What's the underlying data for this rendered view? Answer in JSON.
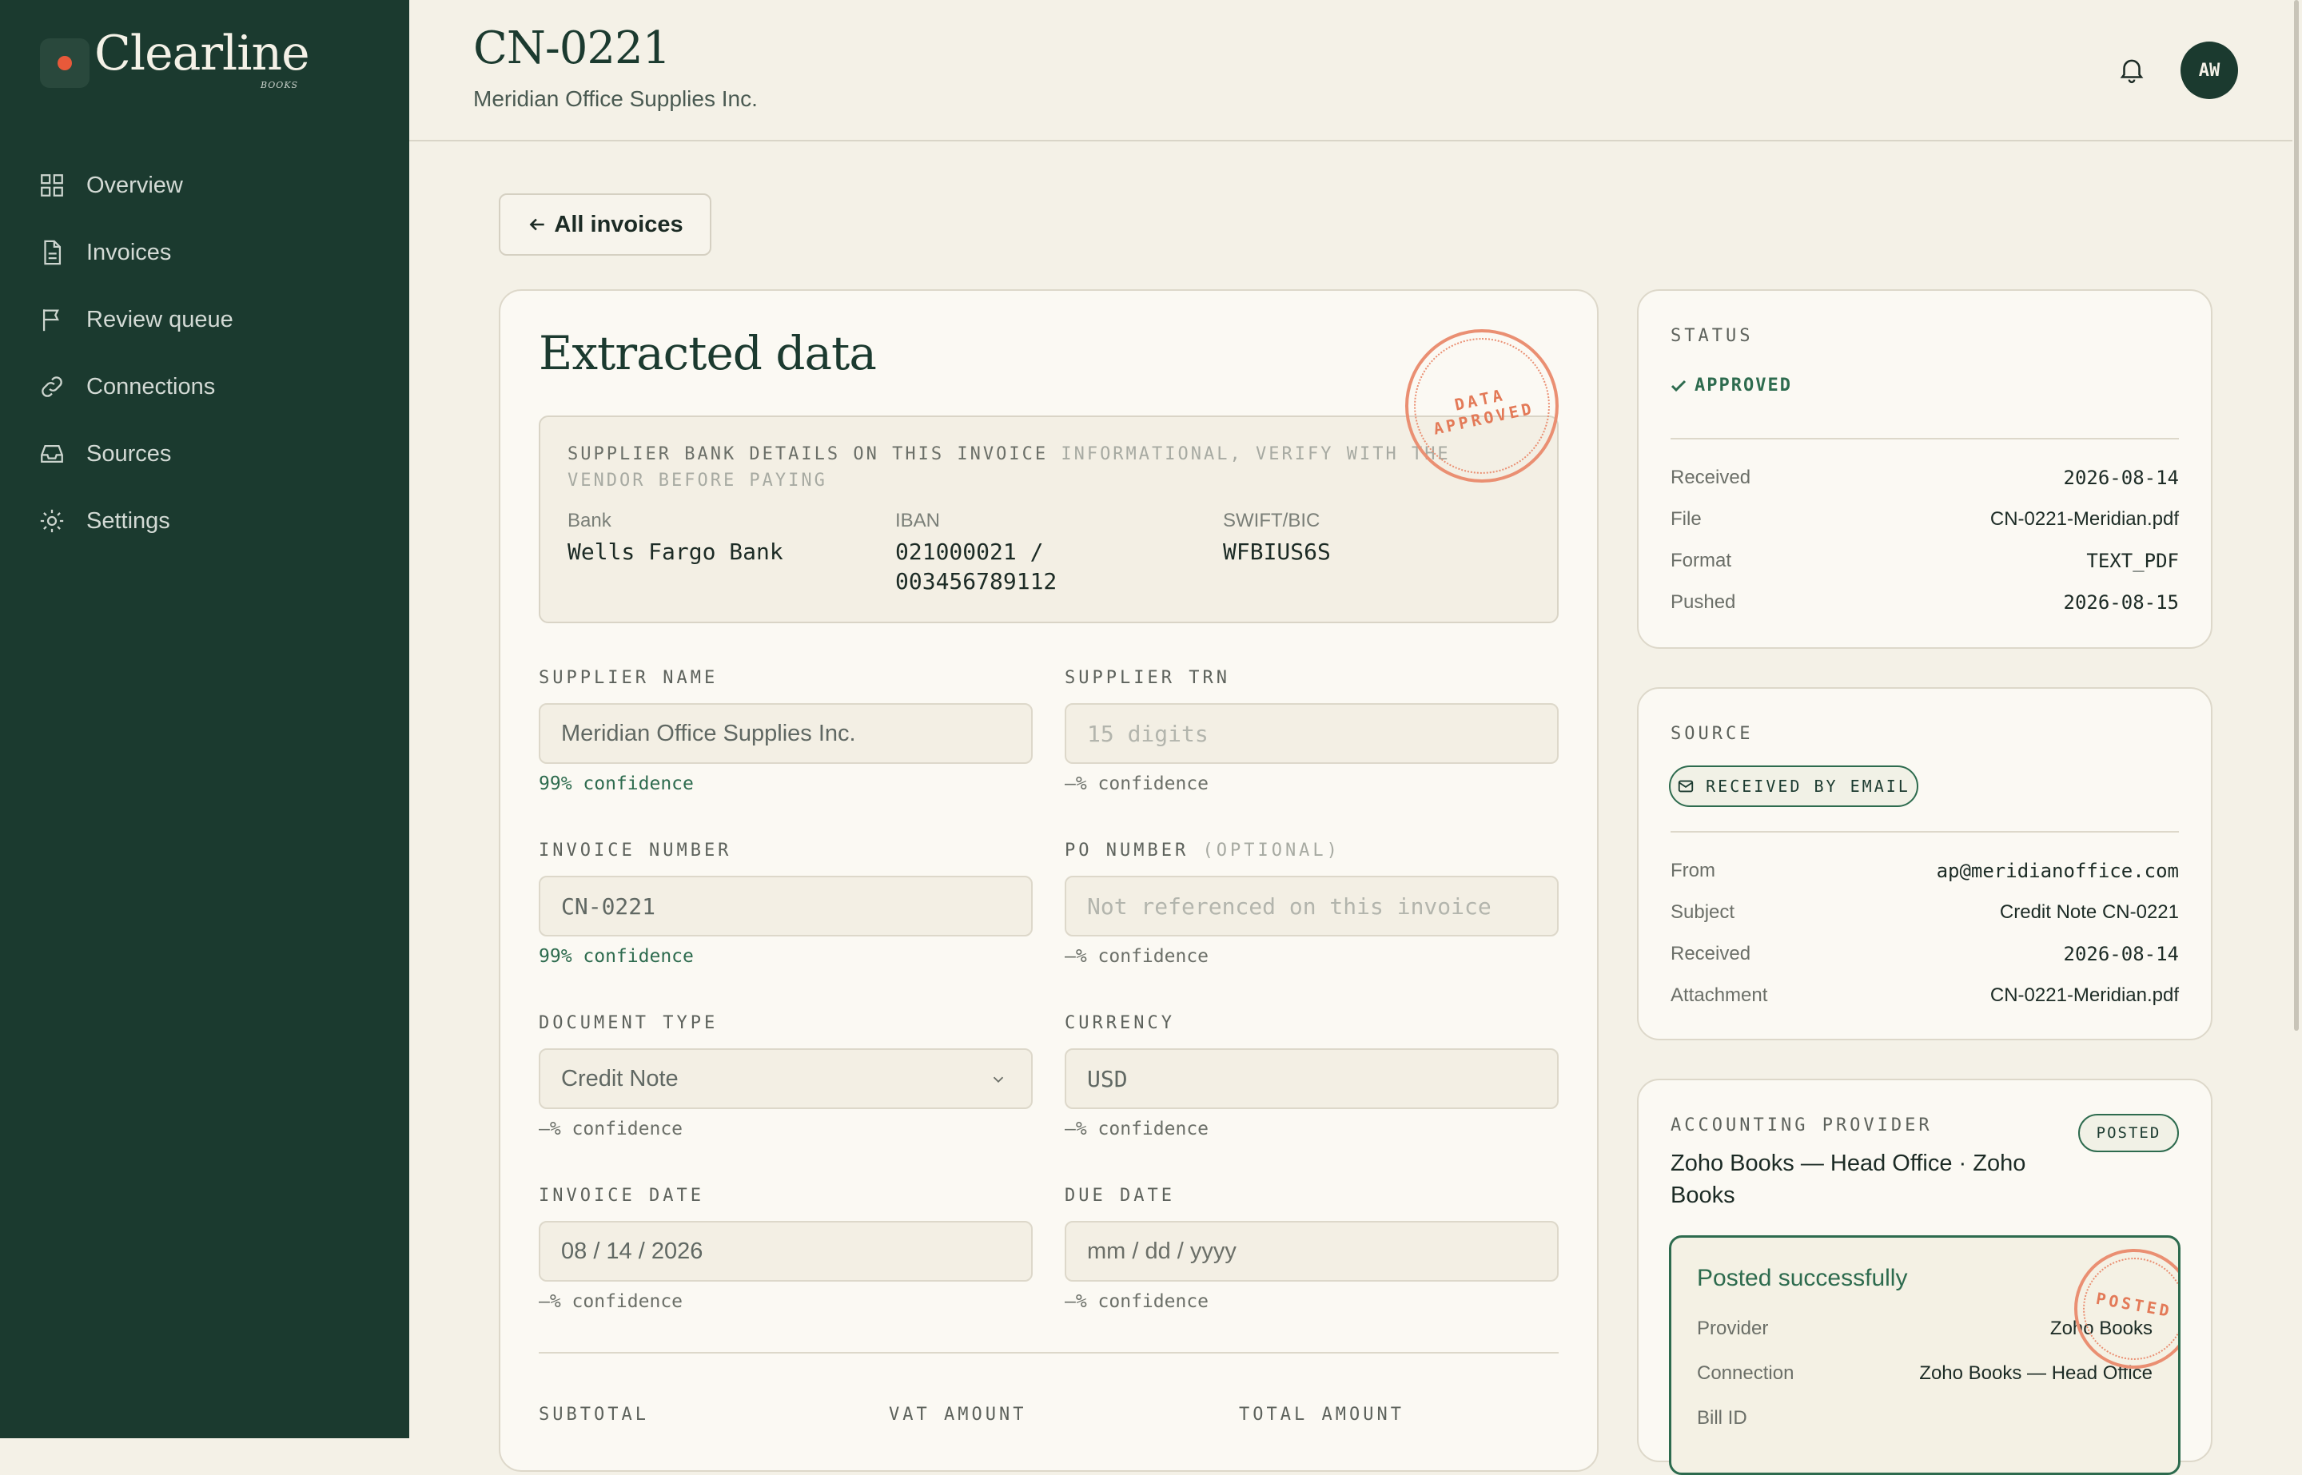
{
  "brand": {
    "name": "Clearline",
    "tag": "BOOKS"
  },
  "nav": [
    {
      "label": "Overview",
      "icon": "grid-icon"
    },
    {
      "label": "Invoices",
      "icon": "document-icon"
    },
    {
      "label": "Review queue",
      "icon": "flag-icon"
    },
    {
      "label": "Connections",
      "icon": "link-icon"
    },
    {
      "label": "Sources",
      "icon": "inbox-icon"
    },
    {
      "label": "Settings",
      "icon": "gear-icon"
    }
  ],
  "header": {
    "title": "CN-0221",
    "subtitle": "Meridian Office Supplies Inc.",
    "avatar": "AW"
  },
  "back_label": "All invoices",
  "extracted": {
    "title": "Extracted data",
    "stamp": [
      "DATA",
      "APPROVED"
    ],
    "bank": {
      "heading": "SUPPLIER BANK DETAILS ON THIS INVOICE",
      "note": "INFORMATIONAL, VERIFY WITH THE VENDOR BEFORE PAYING",
      "bank_label": "Bank",
      "bank_value": "Wells Fargo Bank",
      "iban_label": "IBAN",
      "iban_value_1": "021000021 /",
      "iban_value_2": "003456789112",
      "swift_label": "SWIFT/BIC",
      "swift_value": "WFBIUS6S"
    },
    "fields": {
      "supplier_name": {
        "label": "SUPPLIER NAME",
        "value": "Meridian Office Supplies Inc.",
        "confidence": "99% confidence"
      },
      "supplier_trn": {
        "label": "SUPPLIER TRN",
        "placeholder": "15 digits",
        "confidence": "—% confidence"
      },
      "invoice_number": {
        "label": "INVOICE NUMBER",
        "value": "CN-0221",
        "confidence": "99% confidence"
      },
      "po_number": {
        "label": "PO NUMBER",
        "optional": "(OPTIONAL)",
        "placeholder": "Not referenced on this invoice",
        "confidence": "—% confidence"
      },
      "document_type": {
        "label": "DOCUMENT TYPE",
        "value": "Credit Note",
        "confidence": "—% confidence"
      },
      "currency": {
        "label": "CURRENCY",
        "value": "USD",
        "confidence": "—% confidence"
      },
      "invoice_date": {
        "label": "INVOICE DATE",
        "value": "08 / 14 / 2026",
        "confidence": "—% confidence"
      },
      "due_date": {
        "label": "DUE DATE",
        "placeholder": "mm / dd / yyyy",
        "confidence": "—% confidence"
      }
    },
    "totals": {
      "subtotal": "SUBTOTAL",
      "vat": "VAT AMOUNT",
      "total": "TOTAL AMOUNT"
    }
  },
  "status": {
    "label": "STATUS",
    "value": "APPROVED",
    "rows": [
      {
        "k": "Received",
        "v": "2026-08-14"
      },
      {
        "k": "File",
        "v": "CN-0221-Meridian.pdf"
      },
      {
        "k": "Format",
        "v": "TEXT_PDF"
      },
      {
        "k": "Pushed",
        "v": "2026-08-15"
      }
    ]
  },
  "source": {
    "label": "SOURCE",
    "badge": "RECEIVED BY EMAIL",
    "rows": [
      {
        "k": "From",
        "v": "ap@meridianoffice.com"
      },
      {
        "k": "Subject",
        "v": "Credit Note CN-0221"
      },
      {
        "k": "Received",
        "v": "2026-08-14"
      },
      {
        "k": "Attachment",
        "v": "CN-0221-Meridian.pdf"
      }
    ]
  },
  "provider": {
    "label": "ACCOUNTING PROVIDER",
    "badge": "POSTED",
    "name_line1": "Zoho Books — Head Office · Zoho",
    "name_line2": "Books",
    "result_title": "Posted successfully",
    "stamp": "POSTED",
    "rows": [
      {
        "k": "Provider",
        "v": "Zoho Books"
      },
      {
        "k": "Connection",
        "v": "Zoho Books — Head Office"
      },
      {
        "k": "Bill ID",
        "v": ""
      }
    ]
  },
  "colors": {
    "sidebar": "#1b3a2f",
    "accent": "#e8593a",
    "success": "#2d6b4e",
    "stamp": "#ea8f72"
  }
}
